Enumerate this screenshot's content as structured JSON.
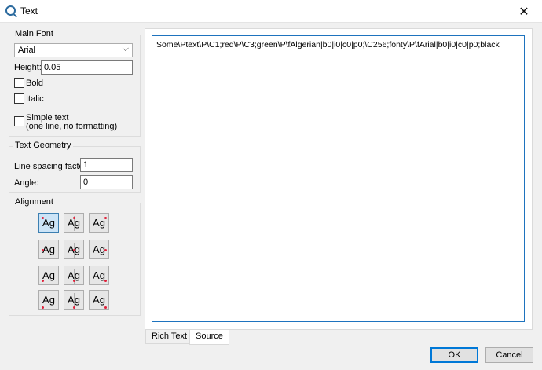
{
  "window": {
    "title": "Text",
    "close_glyph": "✕"
  },
  "main_font": {
    "group_title": "Main Font",
    "font_select": "Arial",
    "height_label": "Height:",
    "height_value": "0.05",
    "bold_label": "Bold",
    "italic_label": "Italic",
    "simple_text_label_1": "Simple text",
    "simple_text_label_2": "(one line, no formatting)"
  },
  "text_geometry": {
    "group_title": "Text Geometry",
    "line_spacing_label": "Line spacing factor:",
    "line_spacing_value": "1",
    "angle_label": "Angle:",
    "angle_value": "0"
  },
  "alignment": {
    "group_title": "Alignment",
    "button_text": "Ag",
    "selected": "top-left",
    "options": [
      "top-left",
      "top-center",
      "top-right",
      "middle-left",
      "middle-center",
      "middle-right",
      "baseline-left",
      "baseline-center",
      "baseline-right",
      "bottom-left",
      "bottom-center",
      "bottom-right"
    ],
    "marker_color": "#e0203a"
  },
  "editor": {
    "content": "Some\\Ptext\\P\\C1;red\\P\\C3;green\\P\\fAlgerian|b0|i0|c0|p0;\\C256;fonty\\P\\fArial|b0|i0|c0|p0;black"
  },
  "tabs": [
    {
      "label": "Rich Text",
      "active": false
    },
    {
      "label": "Source",
      "active": true
    }
  ],
  "buttons": {
    "ok": "OK",
    "cancel": "Cancel"
  },
  "colors": {
    "accent": "#0078d7",
    "selected_bg": "#cce4f7"
  }
}
